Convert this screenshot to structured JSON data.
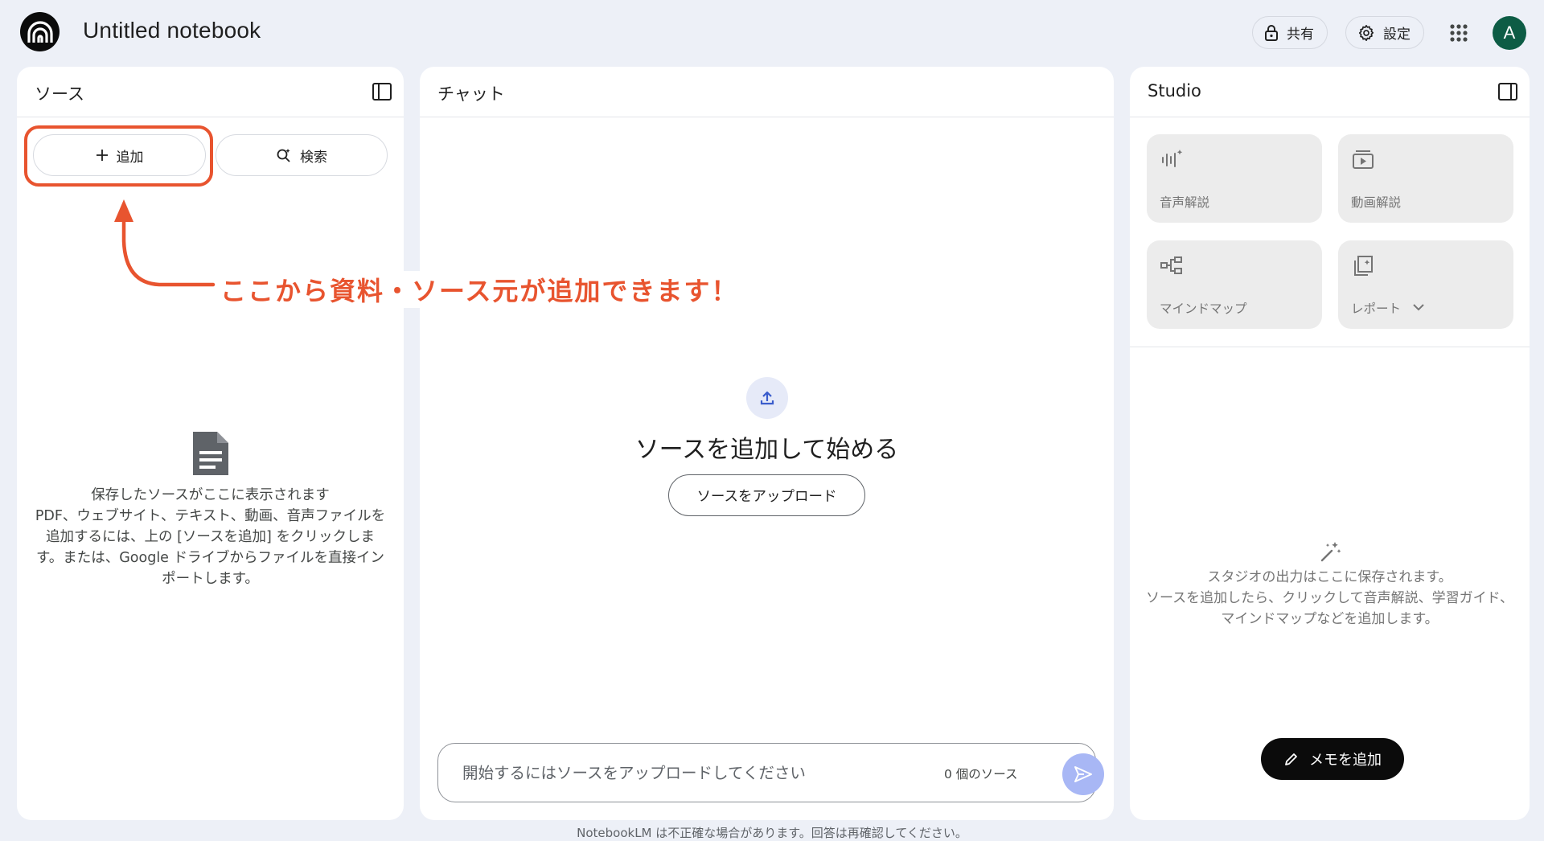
{
  "app": {
    "title": "Untitled notebook",
    "accent": "#e8542f",
    "avatar_letter": "A"
  },
  "header": {
    "share_label": "共有",
    "settings_label": "設定"
  },
  "sources": {
    "title": "ソース",
    "add_label": "追加",
    "search_label": "検索",
    "empty_line1": "保存したソースがここに表示されます",
    "empty_line2": "PDF、ウェブサイト、テキスト、動画、音声ファイルを追加するには、上の [ソースを追加] をクリックします。または、Google ドライブからファイルを直接インポートします。"
  },
  "chat": {
    "title": "チャット",
    "heading": "ソースを追加して始める",
    "upload_label": "ソースをアップロード",
    "input_placeholder": "開始するにはソースをアップロードしてください",
    "source_count": "0 個のソース"
  },
  "studio": {
    "title": "Studio",
    "cards": [
      {
        "label": "音声解説",
        "icon": "audio-waveform-icon"
      },
      {
        "label": "動画解説",
        "icon": "video-icon"
      },
      {
        "label": "マインドマップ",
        "icon": "mind-map-icon"
      },
      {
        "label": "レポート",
        "icon": "report-icon"
      }
    ],
    "empty_line1": "スタジオの出力はここに保存されます。",
    "empty_line2": "ソースを追加したら、クリックして音声解説、学習ガイド、マインドマップなどを追加します。",
    "memo_label": "メモを追加"
  },
  "annotation": {
    "text": "ここから資料・ソース元が追加できます！"
  },
  "footer": {
    "disclaimer": "NotebookLM は不正確な場合があります。回答は再確認してください。"
  }
}
